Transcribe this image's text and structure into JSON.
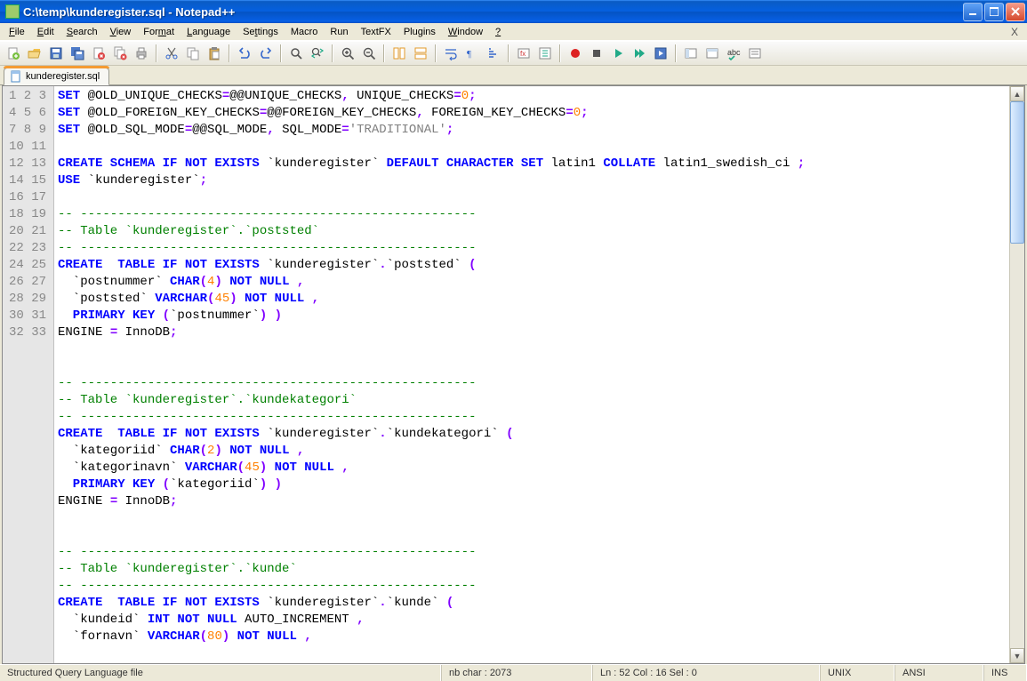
{
  "window": {
    "title": "C:\\temp\\kunderegister.sql - Notepad++"
  },
  "menu": {
    "items": [
      "File",
      "Edit",
      "Search",
      "View",
      "Format",
      "Language",
      "Settings",
      "Macro",
      "Run",
      "TextFX",
      "Plugins",
      "Window",
      "?"
    ]
  },
  "toolbar_icons": [
    "new-file-icon",
    "open-file-icon",
    "save-icon",
    "save-all-icon",
    "close-icon",
    "close-all-icon",
    "print-icon",
    "sep",
    "cut-icon",
    "copy-icon",
    "paste-icon",
    "sep",
    "undo-icon",
    "redo-icon",
    "sep",
    "find-icon",
    "replace-icon",
    "sep",
    "zoom-in-icon",
    "zoom-out-icon",
    "sep",
    "sync-v-icon",
    "sync-h-icon",
    "sep",
    "wrap-icon",
    "all-chars-icon",
    "indent-guide-icon",
    "sep",
    "lang-icon",
    "folding-icon",
    "sep",
    "record-macro-icon",
    "stop-macro-icon",
    "play-macro-icon",
    "play-multi-icon",
    "save-macro-icon",
    "sep",
    "toggle-1-icon",
    "toggle-2-icon",
    "spell-icon",
    "toggle-3-icon"
  ],
  "tab": {
    "name": "kunderegister.sql"
  },
  "code": {
    "lines": [
      [
        [
          "kw",
          "SET"
        ],
        [
          "var",
          " @OLD_UNIQUE_CHECKS"
        ],
        [
          "pun",
          "="
        ],
        [
          "var",
          "@@UNIQUE_CHECKS"
        ],
        [
          "pun",
          ","
        ],
        [
          "var",
          " UNIQUE_CHECKS"
        ],
        [
          "pun",
          "="
        ],
        [
          "num",
          "0"
        ],
        [
          "pun",
          ";"
        ]
      ],
      [
        [
          "kw",
          "SET"
        ],
        [
          "var",
          " @OLD_FOREIGN_KEY_CHECKS"
        ],
        [
          "pun",
          "="
        ],
        [
          "var",
          "@@FOREIGN_KEY_CHECKS"
        ],
        [
          "pun",
          ","
        ],
        [
          "var",
          " FOREIGN_KEY_CHECKS"
        ],
        [
          "pun",
          "="
        ],
        [
          "num",
          "0"
        ],
        [
          "pun",
          ";"
        ]
      ],
      [
        [
          "kw",
          "SET"
        ],
        [
          "var",
          " @OLD_SQL_MODE"
        ],
        [
          "pun",
          "="
        ],
        [
          "var",
          "@@SQL_MODE"
        ],
        [
          "pun",
          ","
        ],
        [
          "var",
          " SQL_MODE"
        ],
        [
          "pun",
          "="
        ],
        [
          "str",
          "'TRADITIONAL'"
        ],
        [
          "pun",
          ";"
        ]
      ],
      [],
      [
        [
          "kw",
          "CREATE SCHEMA IF NOT EXISTS"
        ],
        [
          "ident",
          " `kunderegister` "
        ],
        [
          "kw",
          "DEFAULT CHARACTER SET"
        ],
        [
          "ident",
          " latin1 "
        ],
        [
          "kw",
          "COLLATE"
        ],
        [
          "ident",
          " latin1_swedish_ci "
        ],
        [
          "pun",
          ";"
        ]
      ],
      [
        [
          "kw",
          "USE"
        ],
        [
          "ident",
          " `kunderegister`"
        ],
        [
          "pun",
          ";"
        ]
      ],
      [],
      [
        [
          "cmt",
          "-- -----------------------------------------------------"
        ]
      ],
      [
        [
          "cmt",
          "-- Table `kunderegister`.`poststed`"
        ]
      ],
      [
        [
          "cmt",
          "-- -----------------------------------------------------"
        ]
      ],
      [
        [
          "kw",
          "CREATE  TABLE IF NOT EXISTS"
        ],
        [
          "ident",
          " `kunderegister`"
        ],
        [
          "pun",
          "."
        ],
        [
          "ident",
          "`poststed` "
        ],
        [
          "pun",
          "("
        ]
      ],
      [
        [
          "ident",
          "  `postnummer` "
        ],
        [
          "kw",
          "CHAR"
        ],
        [
          "pun",
          "("
        ],
        [
          "num",
          "4"
        ],
        [
          "pun",
          ")"
        ],
        [
          "kw",
          " NOT NULL "
        ],
        [
          "pun",
          ","
        ]
      ],
      [
        [
          "ident",
          "  `poststed` "
        ],
        [
          "kw",
          "VARCHAR"
        ],
        [
          "pun",
          "("
        ],
        [
          "num",
          "45"
        ],
        [
          "pun",
          ")"
        ],
        [
          "kw",
          " NOT NULL "
        ],
        [
          "pun",
          ","
        ]
      ],
      [
        [
          "kw",
          "  PRIMARY KEY "
        ],
        [
          "pun",
          "("
        ],
        [
          "ident",
          "`postnummer`"
        ],
        [
          "pun",
          ")"
        ],
        [
          "pun",
          " )"
        ]
      ],
      [
        [
          "ident",
          "ENGINE "
        ],
        [
          "pun",
          "="
        ],
        [
          "ident",
          " InnoDB"
        ],
        [
          "pun",
          ";"
        ]
      ],
      [],
      [],
      [
        [
          "cmt",
          "-- -----------------------------------------------------"
        ]
      ],
      [
        [
          "cmt",
          "-- Table `kunderegister`.`kundekategori`"
        ]
      ],
      [
        [
          "cmt",
          "-- -----------------------------------------------------"
        ]
      ],
      [
        [
          "kw",
          "CREATE  TABLE IF NOT EXISTS"
        ],
        [
          "ident",
          " `kunderegister`"
        ],
        [
          "pun",
          "."
        ],
        [
          "ident",
          "`kundekategori` "
        ],
        [
          "pun",
          "("
        ]
      ],
      [
        [
          "ident",
          "  `kategoriid` "
        ],
        [
          "kw",
          "CHAR"
        ],
        [
          "pun",
          "("
        ],
        [
          "num",
          "2"
        ],
        [
          "pun",
          ")"
        ],
        [
          "kw",
          " NOT NULL "
        ],
        [
          "pun",
          ","
        ]
      ],
      [
        [
          "ident",
          "  `kategorinavn` "
        ],
        [
          "kw",
          "VARCHAR"
        ],
        [
          "pun",
          "("
        ],
        [
          "num",
          "45"
        ],
        [
          "pun",
          ")"
        ],
        [
          "kw",
          " NOT NULL "
        ],
        [
          "pun",
          ","
        ]
      ],
      [
        [
          "kw",
          "  PRIMARY KEY "
        ],
        [
          "pun",
          "("
        ],
        [
          "ident",
          "`kategoriid`"
        ],
        [
          "pun",
          ")"
        ],
        [
          "pun",
          " )"
        ]
      ],
      [
        [
          "ident",
          "ENGINE "
        ],
        [
          "pun",
          "="
        ],
        [
          "ident",
          " InnoDB"
        ],
        [
          "pun",
          ";"
        ]
      ],
      [],
      [],
      [
        [
          "cmt",
          "-- -----------------------------------------------------"
        ]
      ],
      [
        [
          "cmt",
          "-- Table `kunderegister`.`kunde`"
        ]
      ],
      [
        [
          "cmt",
          "-- -----------------------------------------------------"
        ]
      ],
      [
        [
          "kw",
          "CREATE  TABLE IF NOT EXISTS"
        ],
        [
          "ident",
          " `kunderegister`"
        ],
        [
          "pun",
          "."
        ],
        [
          "ident",
          "`kunde` "
        ],
        [
          "pun",
          "("
        ]
      ],
      [
        [
          "ident",
          "  `kundeid` "
        ],
        [
          "kw",
          "INT NOT NULL"
        ],
        [
          "ident",
          " AUTO_INCREMENT "
        ],
        [
          "pun",
          ","
        ]
      ],
      [
        [
          "ident",
          "  `fornavn` "
        ],
        [
          "kw",
          "VARCHAR"
        ],
        [
          "pun",
          "("
        ],
        [
          "num",
          "80"
        ],
        [
          "pun",
          ")"
        ],
        [
          "kw",
          " NOT NULL "
        ],
        [
          "pun",
          ","
        ]
      ]
    ]
  },
  "status": {
    "lang": "Structured Query Language file",
    "chars": "nb char : 2073",
    "pos": "Ln : 52   Col : 16   Sel : 0",
    "eol": "UNIX",
    "enc": "ANSI",
    "mode": "INS"
  }
}
